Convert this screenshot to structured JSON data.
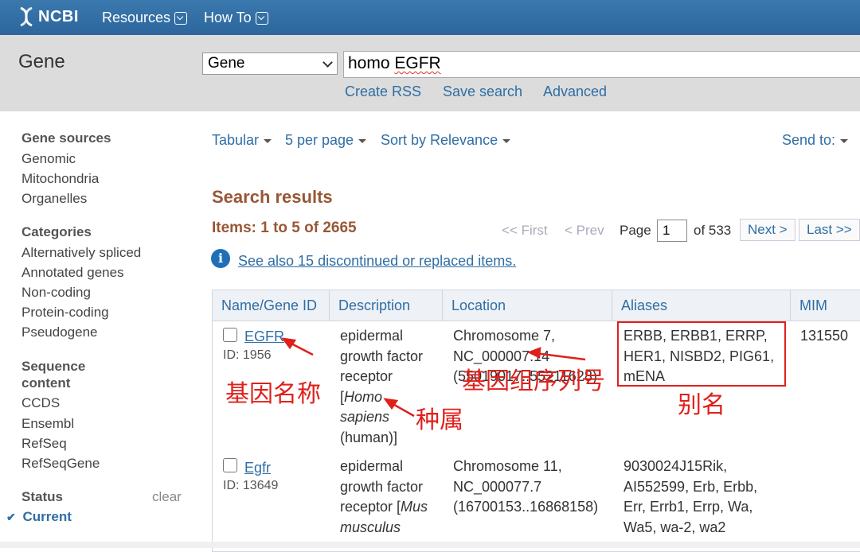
{
  "header": {
    "logo": "NCBI",
    "menus": [
      "Resources",
      "How To"
    ]
  },
  "search": {
    "db_title": "Gene",
    "db_selected": "Gene",
    "query_prefix": "homo ",
    "query_term": "EGFR",
    "links": [
      "Create RSS",
      "Save search",
      "Advanced"
    ]
  },
  "sidebar": {
    "gene_sources": {
      "heading": "Gene sources",
      "items": [
        "Genomic",
        "Mitochondria",
        "Organelles"
      ]
    },
    "categories": {
      "heading": "Categories",
      "items": [
        "Alternatively spliced",
        "Annotated genes",
        "Non-coding",
        "Protein-coding",
        "Pseudogene"
      ]
    },
    "sequence_content": {
      "heading_line1": "Sequence",
      "heading_line2": "content",
      "items": [
        "CCDS",
        "Ensembl",
        "RefSeq",
        "RefSeqGene"
      ]
    },
    "status": {
      "heading": "Status",
      "clear": "clear",
      "current": "Current"
    }
  },
  "toolbar": {
    "format": "Tabular",
    "per_page": "5 per page",
    "sort": "Sort by Relevance",
    "send_to": "Send to:"
  },
  "results": {
    "heading": "Search results",
    "count": "Items: 1 to 5 of 2665",
    "first": "<< First",
    "prev": "< Prev",
    "page_label": "Page",
    "page_value": "1",
    "of_pages": "of 533",
    "next": "Next >",
    "last": "Last >>",
    "see_also": "See also 15 discontinued or replaced items."
  },
  "table": {
    "columns": [
      "Name/Gene ID",
      "Description",
      "Location",
      "Aliases",
      "MIM"
    ],
    "rows": [
      {
        "name": "EGFR",
        "id": "ID: 1956",
        "desc": [
          "epidermal",
          "growth factor",
          "receptor"
        ],
        "desc_species_open": "[",
        "desc_species_italic1": "Homo",
        "desc_species_italic2": "sapiens",
        "desc_common": "(human)]",
        "loc": [
          "Chromosome 7,",
          "NC_000007.14",
          "(55019017..55211628)"
        ],
        "aliases": [
          "ERBB, ERBB1, ERRP,",
          "HER1, NISBD2, PIG61,",
          "mENA"
        ],
        "mim": "131550"
      },
      {
        "name": "Egfr",
        "id": "ID: 13649",
        "desc": [
          "epidermal",
          "growth factor"
        ],
        "desc_line3": "receptor [",
        "desc_species_italic1": "Mus",
        "desc_species_italic2": "musculus",
        "loc": [
          "Chromosome 11,",
          "NC_000077.7",
          "(16700153..16868158)"
        ],
        "aliases": [
          "9030024J15Rik,",
          "AI552599, Erb, Erbb,",
          "Err, Errb1, Errp, Wa,",
          "Wa5, wa-2, wa2"
        ],
        "mim": ""
      }
    ]
  },
  "annotations": {
    "gene_name": "基因名称",
    "species": "种属",
    "accession": "基因组序列号",
    "alias": "别名",
    "color": "#e0201b"
  }
}
